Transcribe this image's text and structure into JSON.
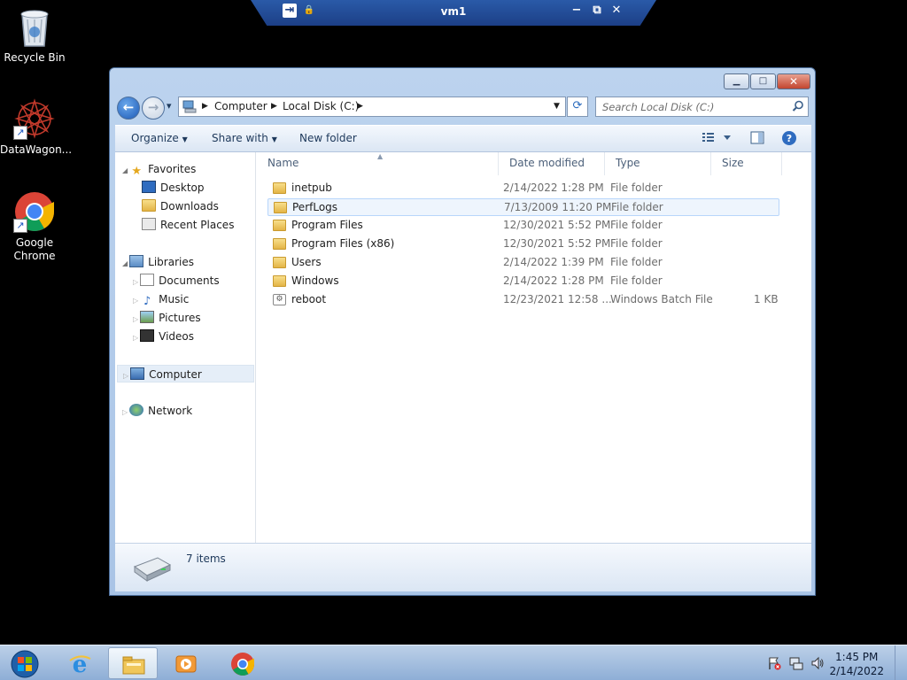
{
  "desktop": {
    "icons": [
      {
        "label": "Recycle Bin"
      },
      {
        "label": "DataWagon..."
      },
      {
        "label": "Google Chrome"
      }
    ]
  },
  "rdp": {
    "title": "vm1",
    "pin": "⇥",
    "lock": "🔒",
    "minimize": "−",
    "restore": "⧉",
    "close": "✕"
  },
  "window": {
    "minimize": "▁",
    "maximize": "□",
    "close": "✕",
    "nav": {
      "back": "←",
      "forward": "→",
      "recent": "▾",
      "breadcrumb": [
        "Computer",
        "Local Disk (C:)"
      ],
      "refresh": "⟳",
      "search_placeholder": "Search Local Disk (C:)"
    },
    "commands": {
      "organize": "Organize",
      "share": "Share with",
      "new_folder": "New folder"
    },
    "navpane": {
      "favorites": "Favorites",
      "desktop": "Desktop",
      "downloads": "Downloads",
      "recent": "Recent Places",
      "libraries": "Libraries",
      "documents": "Documents",
      "music": "Music",
      "pictures": "Pictures",
      "videos": "Videos",
      "computer": "Computer",
      "network": "Network"
    },
    "columns": {
      "name": "Name",
      "date": "Date modified",
      "type": "Type",
      "size": "Size"
    },
    "files": [
      {
        "name": "inetpub",
        "date": "2/14/2022 1:28 PM",
        "type": "File folder",
        "size": "",
        "kind": "folder"
      },
      {
        "name": "PerfLogs",
        "date": "7/13/2009 11:20 PM",
        "type": "File folder",
        "size": "",
        "kind": "folder"
      },
      {
        "name": "Program Files",
        "date": "12/30/2021 5:52 PM",
        "type": "File folder",
        "size": "",
        "kind": "folder"
      },
      {
        "name": "Program Files (x86)",
        "date": "12/30/2021 5:52 PM",
        "type": "File folder",
        "size": "",
        "kind": "folder"
      },
      {
        "name": "Users",
        "date": "2/14/2022 1:39 PM",
        "type": "File folder",
        "size": "",
        "kind": "folder"
      },
      {
        "name": "Windows",
        "date": "2/14/2022 1:28 PM",
        "type": "File folder",
        "size": "",
        "kind": "folder"
      },
      {
        "name": "reboot",
        "date": "12/23/2021 12:58 ...",
        "type": "Windows Batch File",
        "size": "1 KB",
        "kind": "batch"
      }
    ],
    "status": {
      "item_count": "7 items"
    }
  },
  "taskbar": {
    "time": "1:45 PM",
    "date": "2/14/2022"
  },
  "colors": {
    "window_frame": "#a9c4e6",
    "selection": "#e5eef8",
    "hover_border": "#b8d6fb",
    "taskbar": "#8eaed6"
  }
}
